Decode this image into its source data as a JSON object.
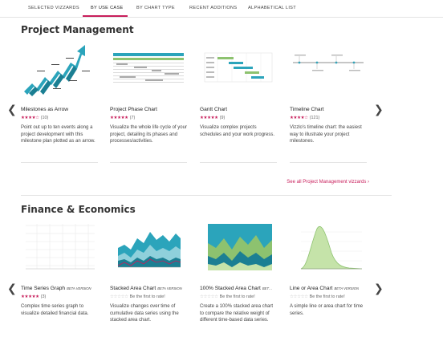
{
  "tabs": [
    {
      "label": "Selected Vizzards"
    },
    {
      "label": "By Use Case"
    },
    {
      "label": "By Chart Type"
    },
    {
      "label": "Recent Additions"
    },
    {
      "label": "Alphabetical List"
    }
  ],
  "sections": [
    {
      "title": "Project Management",
      "see_all": "See all Project Management vizzards ›",
      "cards": [
        {
          "title": "Milestones as Arrow",
          "beta": "",
          "stars": "★★★★☆",
          "rating_text": "(10)",
          "desc": "Point out up to ten events along a project development with this milestone plan plotted as an arrow."
        },
        {
          "title": "Project Phase Chart",
          "beta": "",
          "stars": "★★★★★",
          "rating_text": "(7)",
          "desc": "Visualize the whole life cycle of your project, detailing its phases and processes/activities."
        },
        {
          "title": "Gantt Chart",
          "beta": "",
          "stars": "★★★★★",
          "rating_text": "(9)",
          "desc": "Visualize complex projects schedules and your work progress."
        },
        {
          "title": "Timeline Chart",
          "beta": "",
          "stars": "★★★★☆",
          "rating_text": "(121)",
          "desc": "Vizzlo's timeline chart: the easiest way to illustrate your project milestones."
        }
      ]
    },
    {
      "title": "Finance & Economics",
      "see_all": "",
      "cards": [
        {
          "title": "Time Series Graph",
          "beta": "Beta version",
          "stars": "★★★★★",
          "rating_text": "(3)",
          "desc": "Complex time series graph to visualize detailed financial data."
        },
        {
          "title": "Stacked Area Chart",
          "beta": "Beta version",
          "stars": "☆☆☆☆☆",
          "rating_text": "Be the first to rate!",
          "desc": "Visualize changes over time of cumulative data series using the stacked area chart."
        },
        {
          "title": "100% Stacked Area Chart",
          "beta": "Bet…",
          "stars": "☆☆☆☆☆",
          "rating_text": "Be the first to rate!",
          "desc": "Create a 100% stacked area chart to compare the relative weight of different time-based data series."
        },
        {
          "title": "Line or Area Chart",
          "beta": "Beta version",
          "stars": "☆☆☆☆☆",
          "rating_text": "Be the first to rate!",
          "desc": "A simple line or area chart for time series."
        }
      ]
    }
  ],
  "icons": {
    "prev": "chevron-left-icon",
    "next": "chevron-right-icon",
    "star": "star-icon"
  },
  "colors": {
    "accent": "#c81e5b",
    "teal": "#2ba4bb",
    "green": "#8dc26f"
  }
}
